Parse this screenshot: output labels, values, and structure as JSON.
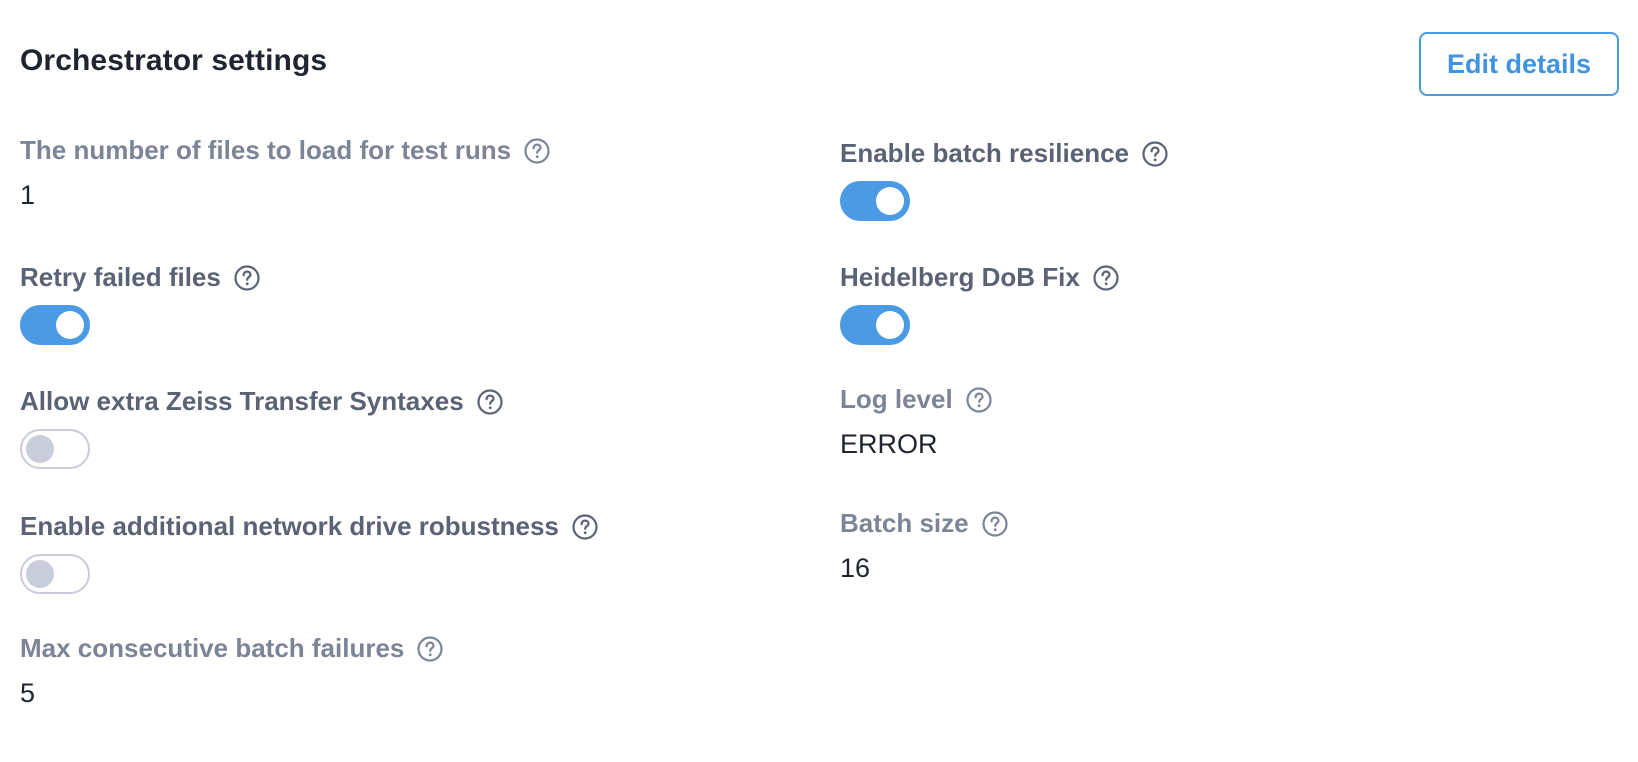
{
  "header": {
    "title": "Orchestrator settings",
    "edit_label": "Edit details"
  },
  "left": {
    "files_to_load": {
      "label": "The number of files to load for test runs",
      "value": "1"
    },
    "retry_failed": {
      "label": "Retry failed files",
      "enabled": true
    },
    "zeiss_syntaxes": {
      "label": "Allow extra Zeiss Transfer Syntaxes",
      "enabled": false
    },
    "network_robustness": {
      "label": "Enable additional network drive robustness",
      "enabled": false
    },
    "max_batch_failures": {
      "label": "Max consecutive batch failures",
      "value": "5"
    }
  },
  "right": {
    "batch_resilience": {
      "label": "Enable batch resilience",
      "enabled": true
    },
    "heidelberg_fix": {
      "label": "Heidelberg DoB Fix",
      "enabled": true
    },
    "log_level": {
      "label": "Log level",
      "value": "ERROR"
    },
    "batch_size": {
      "label": "Batch size",
      "value": "16"
    }
  },
  "icons": {
    "help": "help-circle-icon"
  },
  "colors": {
    "accent": "#4a9be3",
    "toggle_off_track": "#c9ccd9",
    "label_muted": "#7b8597",
    "label_strong": "#5a6375",
    "text": "#1f2430"
  }
}
